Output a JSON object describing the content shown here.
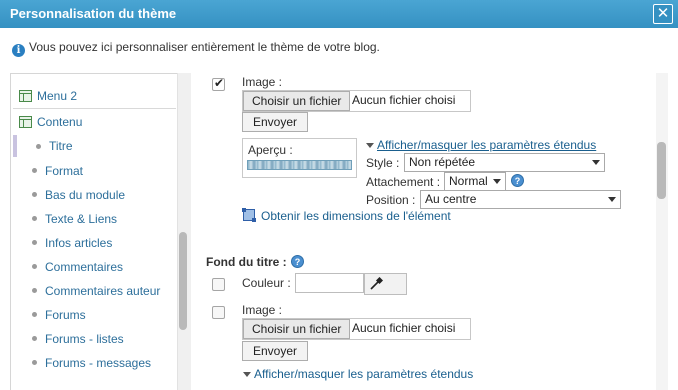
{
  "window": {
    "title": "Personnalisation du thème",
    "close_label": "✕"
  },
  "info": {
    "text": "Vous pouvez ici personnaliser entièrement le thème de votre blog."
  },
  "sidebar": {
    "items": [
      {
        "label": "Menu 2"
      },
      {
        "label": "Contenu"
      },
      {
        "label": "Titre"
      },
      {
        "label": "Format"
      },
      {
        "label": "Bas du module"
      },
      {
        "label": "Texte & Liens"
      },
      {
        "label": "Infos articles"
      },
      {
        "label": "Commentaires"
      },
      {
        "label": "Commentaires auteur"
      },
      {
        "label": "Forums"
      },
      {
        "label": "Forums - listes"
      },
      {
        "label": "Forums - messages"
      }
    ]
  },
  "image_section": {
    "label": "Image :",
    "checked": true,
    "choose_file": "Choisir un fichier",
    "file_status": "Aucun fichier choisi",
    "send": "Envoyer",
    "preview_label": "Aperçu :",
    "toggle_link": "Afficher/masquer les paramètres étendus",
    "style_label": "Style :",
    "style_value": "Non répétée",
    "attachment_label": "Attachement :",
    "attachment_value": "Normal",
    "position_label": "Position :",
    "position_value": "Au centre",
    "dimensions_link": "Obtenir les dimensions de l'élément"
  },
  "title_bg_section": {
    "heading": "Fond du titre :",
    "color_label": "Couleur :",
    "color_value": "",
    "image_label": "Image :",
    "choose_file": "Choisir un fichier",
    "file_status": "Aucun fichier choisi",
    "send": "Envoyer",
    "toggle_link": "Afficher/masquer les paramètres étendus"
  }
}
